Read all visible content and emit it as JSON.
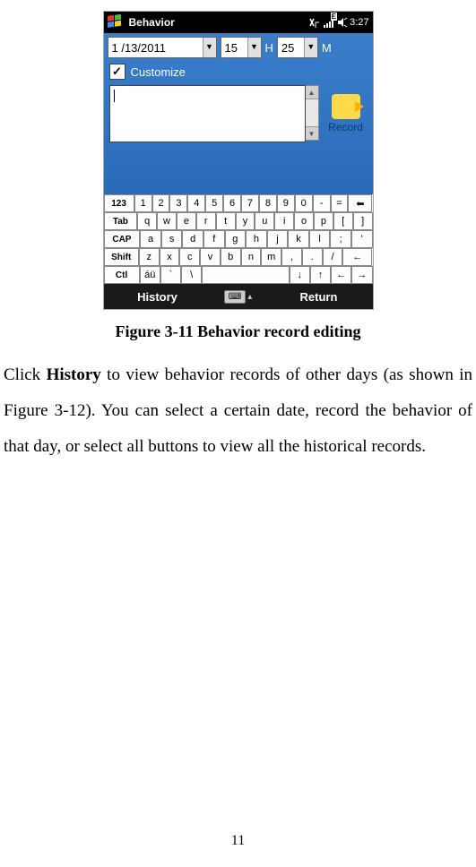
{
  "status_bar": {
    "title": "Behavior",
    "signal_label": "E",
    "time": "3:27"
  },
  "date_row": {
    "date": "1 /13/2011",
    "hour": "15",
    "hour_label": "H",
    "minute": "25",
    "minute_label": "M"
  },
  "customize": {
    "checked": "✓",
    "label": "Customize"
  },
  "textarea_value": "",
  "record_button": {
    "label": "Record"
  },
  "keyboard": {
    "row1_mod": "123",
    "row1": [
      "1",
      "2",
      "3",
      "4",
      "5",
      "6",
      "7",
      "8",
      "9",
      "0",
      "-",
      "="
    ],
    "row1_back": "⬅",
    "row2_mod": "Tab",
    "row2": [
      "q",
      "w",
      "e",
      "r",
      "t",
      "y",
      "u",
      "i",
      "o",
      "p",
      "[",
      "]"
    ],
    "row3_mod": "CAP",
    "row3": [
      "a",
      "s",
      "d",
      "f",
      "g",
      "h",
      "j",
      "k",
      "l",
      ";",
      "'"
    ],
    "row4_mod": "Shift",
    "row4": [
      "z",
      "x",
      "c",
      "v",
      "b",
      "n",
      "m",
      ",",
      ".",
      "/",
      "←"
    ],
    "row5_mod": "Ctl",
    "row5_extra": [
      "áü",
      "`",
      "\\"
    ],
    "row5_arrows": [
      "↓",
      "↑",
      "←",
      "→"
    ]
  },
  "bottom_bar": {
    "left": "History",
    "right": "Return",
    "center_up": "▴"
  },
  "caption": "Figure 3-11 Behavior record editing",
  "body": {
    "pre": "Click ",
    "bold": "History",
    "post": " to view behavior records of other days (as shown in Figure 3-12). You can select a certain date, record the behavior of that day, or select all buttons to view all the historical records."
  },
  "page_number": "11"
}
